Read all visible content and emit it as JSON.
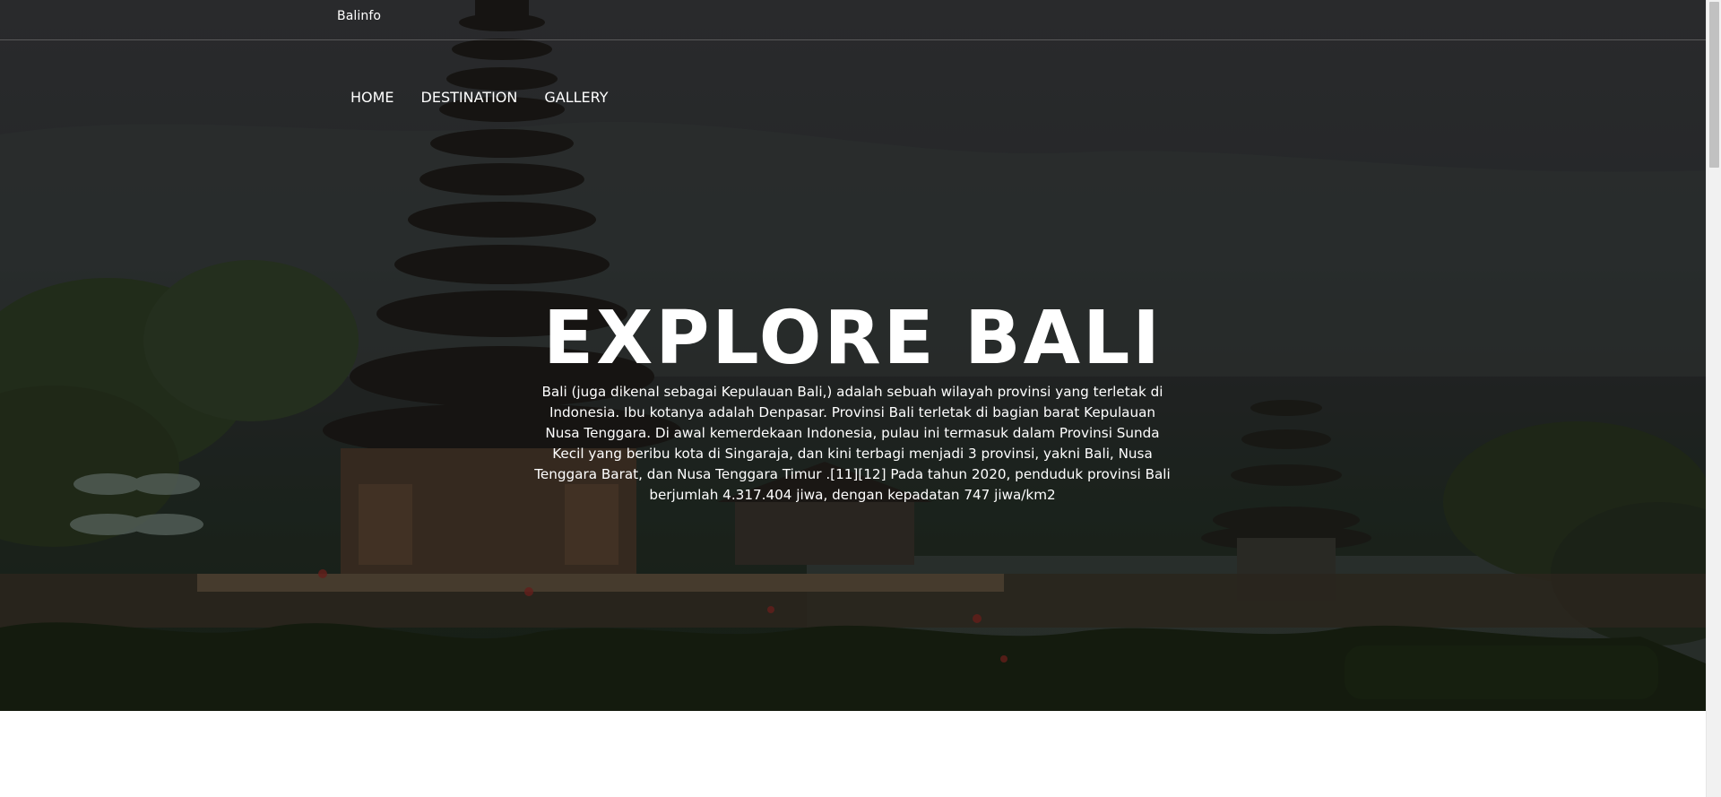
{
  "header": {
    "brand": "Balinfo"
  },
  "nav": {
    "items": [
      {
        "label": "HOME"
      },
      {
        "label": "DESTINATION"
      },
      {
        "label": "GALLERY"
      }
    ]
  },
  "hero": {
    "title": "EXPLORE BALI",
    "description": "Bali (juga dikenal sebagai Kepulauan Bali,) adalah sebuah wilayah provinsi yang terletak di Indonesia. Ibu kotanya adalah Denpasar. Provinsi Bali terletak di bagian barat Kepulauan Nusa Tenggara. Di awal kemerdekaan Indonesia, pulau ini termasuk dalam Provinsi Sunda Kecil yang beribu kota di Singaraja, dan kini terbagi menjadi 3 provinsi, yakni Bali, Nusa Tenggara Barat, dan Nusa Tenggara Timur .[11][12] Pada tahun 2020, penduduk provinsi Bali berjumlah 4.317.404 jiwa, dengan kepadatan 747 jiwa/km2",
    "background_image": "temple-photo"
  },
  "colors": {
    "text": "#ffffff",
    "page_background": "#ffffff",
    "scrollbar_track": "#f1f1f1",
    "scrollbar_thumb": "#c1c1c1"
  }
}
